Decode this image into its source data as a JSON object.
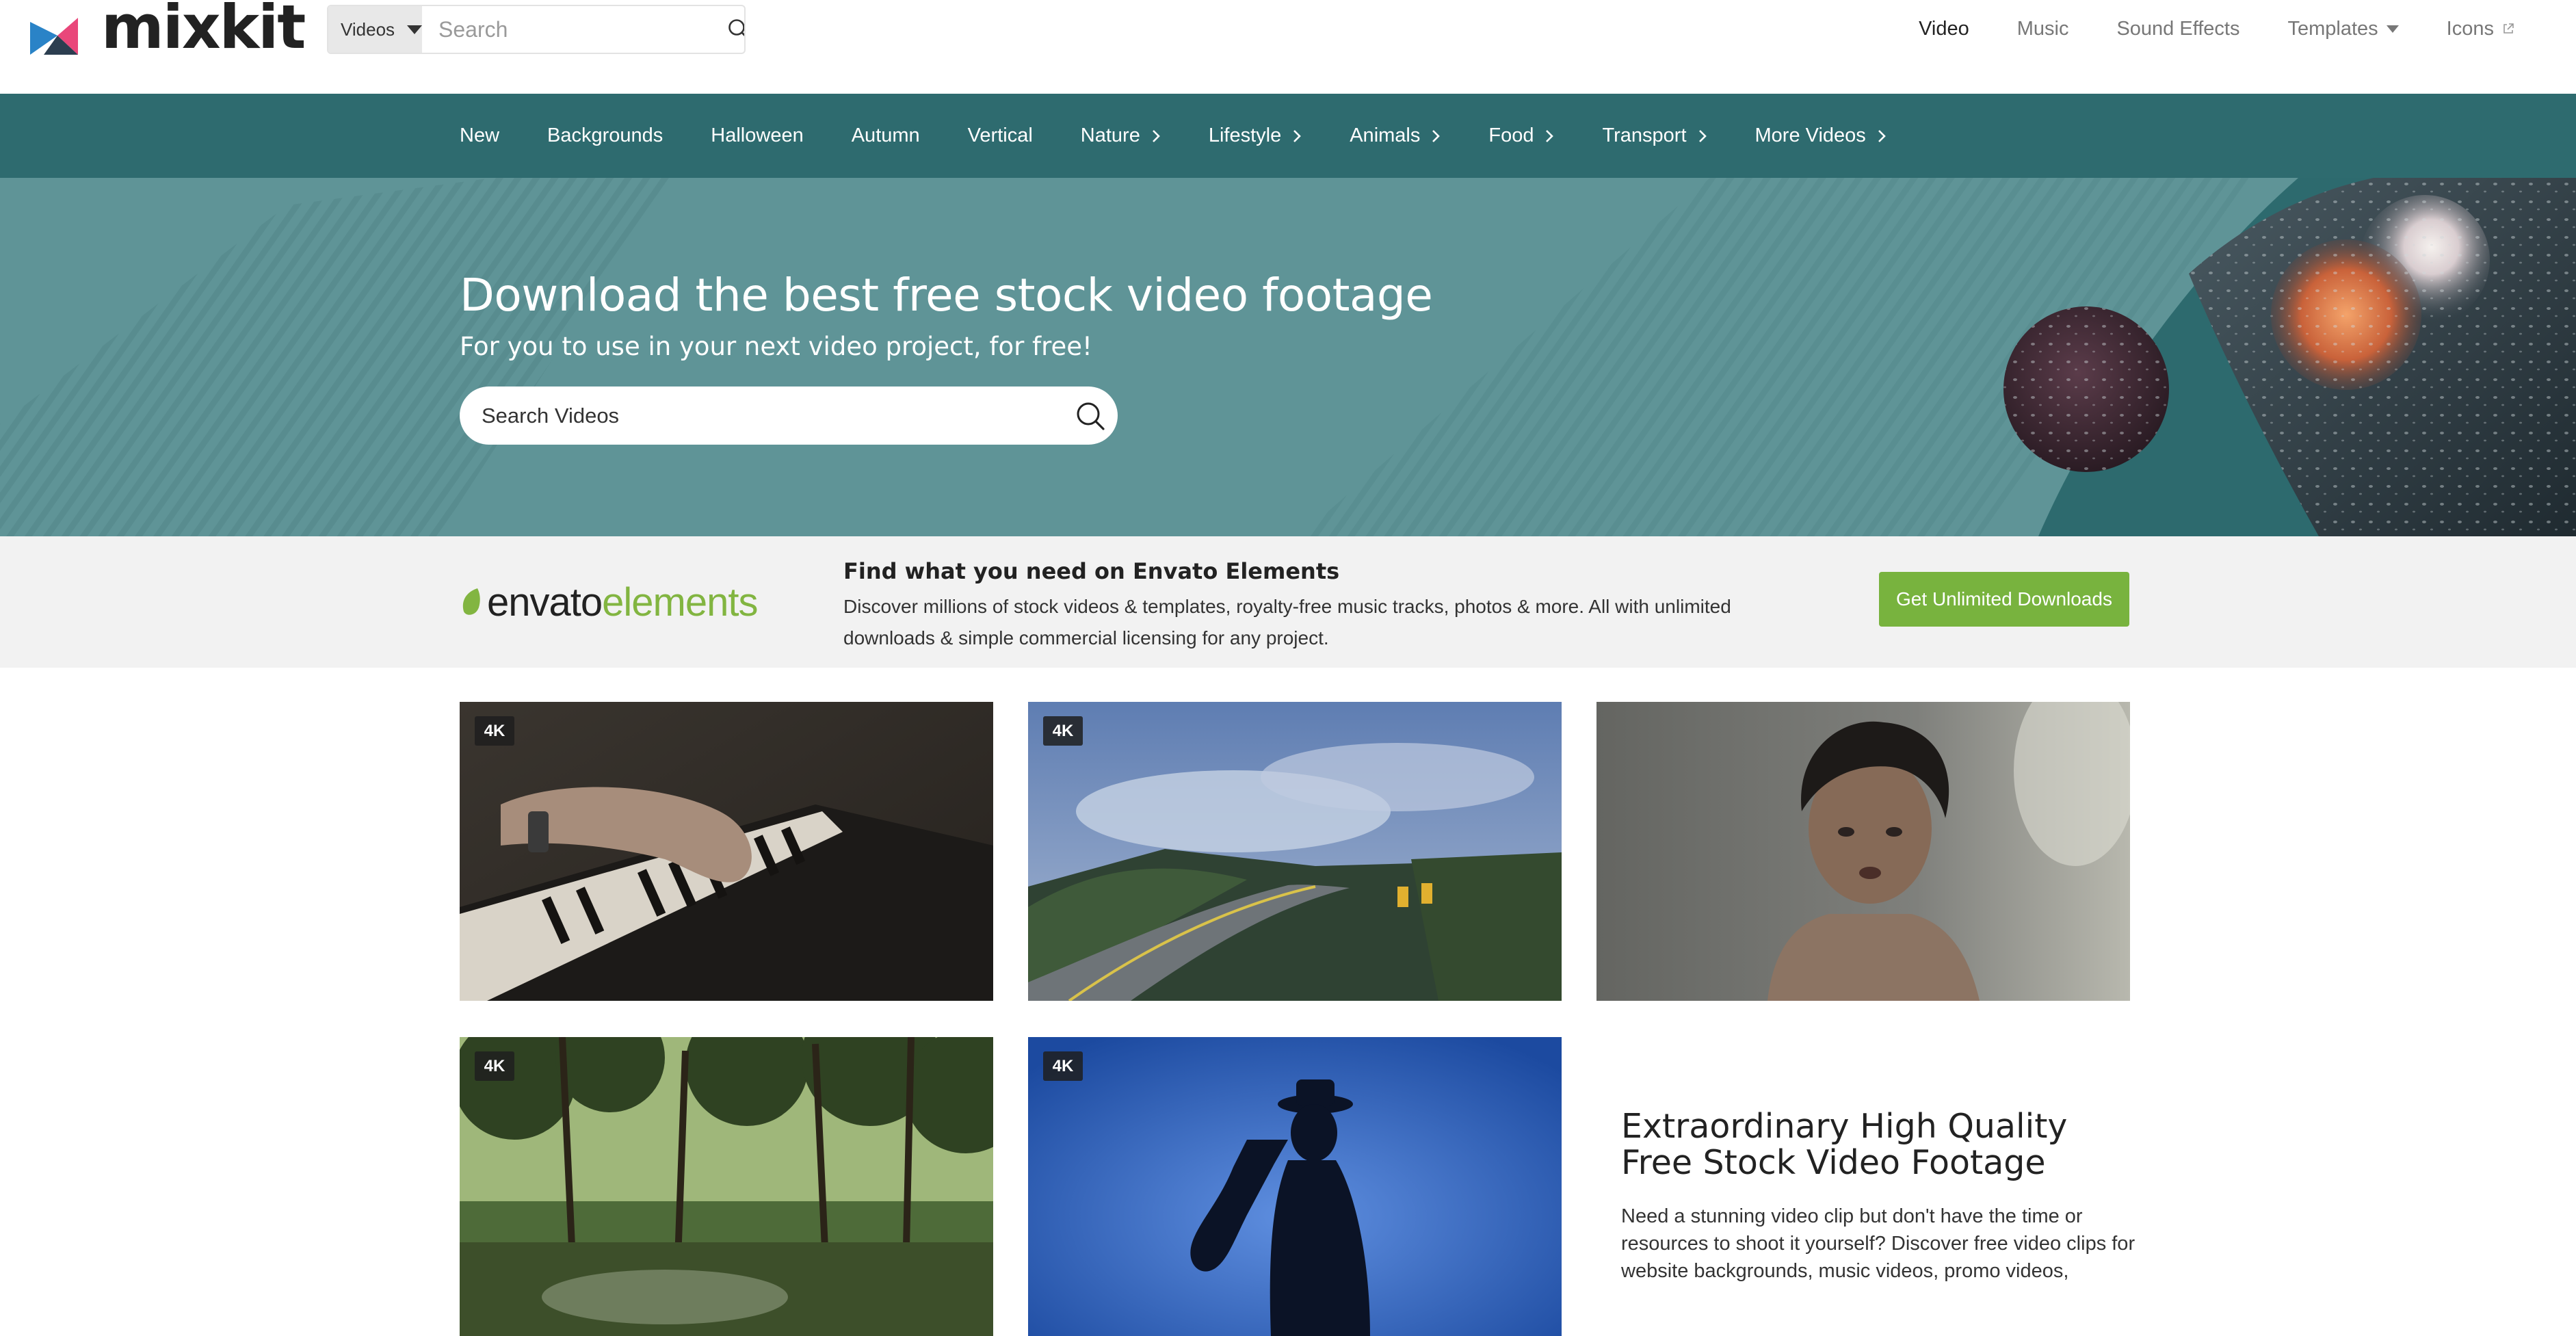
{
  "header": {
    "logo_text": "mixkit",
    "search": {
      "type_label": "Videos",
      "placeholder": "Search"
    },
    "nav": [
      {
        "label": "Video",
        "active": true
      },
      {
        "label": "Music"
      },
      {
        "label": "Sound Effects"
      },
      {
        "label": "Templates",
        "has_dropdown": true
      },
      {
        "label": "Icons",
        "external": true
      }
    ]
  },
  "categories": [
    {
      "label": "New"
    },
    {
      "label": "Backgrounds"
    },
    {
      "label": "Halloween"
    },
    {
      "label": "Autumn"
    },
    {
      "label": "Vertical"
    },
    {
      "label": "Nature",
      "has_submenu": true
    },
    {
      "label": "Lifestyle",
      "has_submenu": true
    },
    {
      "label": "Animals",
      "has_submenu": true
    },
    {
      "label": "Food",
      "has_submenu": true
    },
    {
      "label": "Transport",
      "has_submenu": true
    },
    {
      "label": "More Videos",
      "has_submenu": true
    }
  ],
  "hero": {
    "title": "Download the best free stock video footage",
    "subtitle": "For you to use in your next video project, for free!",
    "search_placeholder": "Search Videos"
  },
  "envato": {
    "logo_word1": "envato",
    "logo_word2": "elements",
    "heading": "Find what you need on Envato Elements",
    "text": "Discover millions of stock videos & templates, royalty-free music tracks, photos & more. All with unlimited downloads & simple commercial licensing for any project.",
    "button_label": "Get Unlimited Downloads"
  },
  "videos": [
    {
      "badge": "4K",
      "subject": "hands playing piano"
    },
    {
      "badge": "4K",
      "subject": "winding road under cloudy sky"
    },
    {
      "badge": "",
      "subject": "woman looking startled"
    },
    {
      "badge": "4K",
      "subject": "forest stream"
    },
    {
      "badge": "4K",
      "subject": "saxophone player silhouette"
    }
  ],
  "info": {
    "title": "Extraordinary High Quality Free Stock Video Footage",
    "text": "Need a stunning video clip but don't have the time or resources to shoot it yourself? Discover free video clips for website backgrounds, music videos, promo videos,"
  },
  "colors": {
    "teal_bar": "#2e6b6f",
    "hero_bg": "#5f9497",
    "envato_green": "#82b541",
    "button_green": "#78b33e"
  }
}
